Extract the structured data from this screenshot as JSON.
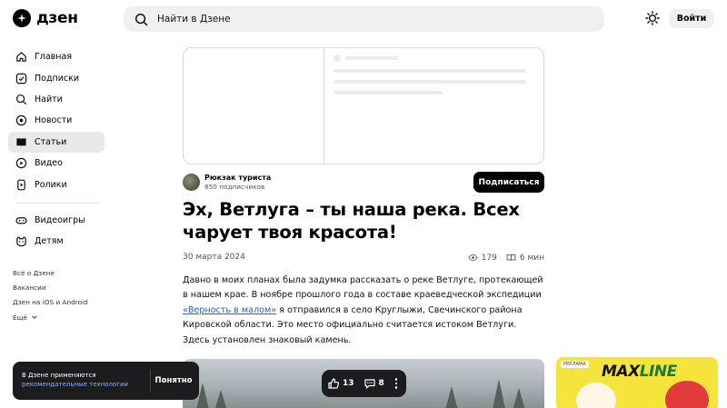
{
  "header": {
    "logo_text": "дзен",
    "search_placeholder": "Найти в Дзене",
    "login_label": "Войти"
  },
  "sidebar": {
    "items": [
      {
        "label": "Главная",
        "icon": "home-icon"
      },
      {
        "label": "Подписки",
        "icon": "subscriptions-icon"
      },
      {
        "label": "Найти",
        "icon": "search-icon"
      },
      {
        "label": "Новости",
        "icon": "news-icon"
      },
      {
        "label": "Статьи",
        "icon": "articles-icon",
        "active": true
      },
      {
        "label": "Видео",
        "icon": "video-icon"
      },
      {
        "label": "Ролики",
        "icon": "shorts-icon"
      }
    ],
    "extra_items": [
      {
        "label": "Видеоигры",
        "icon": "gamepad-icon"
      },
      {
        "label": "Детям",
        "icon": "kids-icon"
      }
    ],
    "footer_links": [
      "Всё о Дзене",
      "Вакансии",
      "Дзен на iOS и Android",
      "Ещё"
    ]
  },
  "article": {
    "author_name": "Рюкзак туриста",
    "author_subs": "850 подписчиков",
    "subscribe_label": "Подписаться",
    "title": "Эх, Ветлуга – ты наша река. Всех чарует твоя красота!",
    "date": "30 марта 2024",
    "views": "179",
    "read_time": "6 мин",
    "body_part1": "Давно в моих планах была задумка рассказать о реке Ветлуге, протекающей в нашем крае. В ноябре прошлого года в составе краеведческой экспедиции ",
    "body_link": "«Верность в малом»",
    "body_part2": " я отправился в село Круглыжи, Свечинского района Кировской области. Это место официально считается истоком Ветлуги. Здесь установлен знаковый камень."
  },
  "actions": {
    "likes": "13",
    "comments": "8"
  },
  "cookie": {
    "text": "В Дзене применяются",
    "link": "рекомендательные технологии",
    "button": "Понятно"
  },
  "ad": {
    "label": "РЕКЛАМА",
    "brand_part1": "MAX",
    "brand_part2": "LINE"
  }
}
